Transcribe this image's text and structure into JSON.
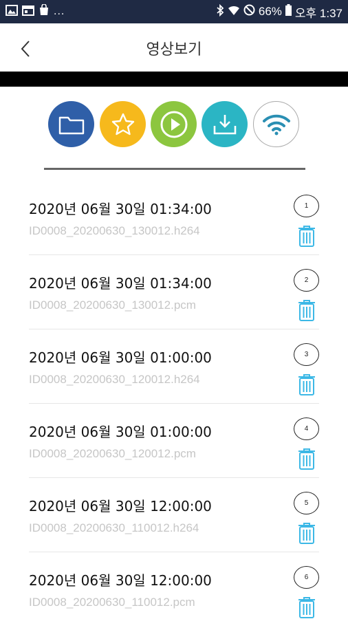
{
  "status_bar": {
    "battery": "66%",
    "time": "오후 1:37",
    "dots": "..."
  },
  "app_bar": {
    "title": "영상보기"
  },
  "tabs": [
    {
      "icon": "folder-icon",
      "color": "#2f5fa8"
    },
    {
      "icon": "star-icon",
      "color": "#f6b91c"
    },
    {
      "icon": "play-icon",
      "color": "#8cc63f"
    },
    {
      "icon": "download-icon",
      "color": "#2bb5c4"
    },
    {
      "icon": "wifi-icon",
      "color": "#ffffff"
    }
  ],
  "colors": {
    "status_bar": "#1f2a44",
    "trash": "#3cb8e6"
  },
  "recordings": [
    {
      "number": "1",
      "date": "2020년 06월 30일 01:34:00",
      "file": "ID0008_20200630_130012.h264"
    },
    {
      "number": "2",
      "date": "2020년 06월 30일 01:34:00",
      "file": "ID0008_20200630_130012.pcm"
    },
    {
      "number": "3",
      "date": "2020년 06월 30일 01:00:00",
      "file": "ID0008_20200630_120012.h264"
    },
    {
      "number": "4",
      "date": "2020년 06월 30일 01:00:00",
      "file": "ID0008_20200630_120012.pcm"
    },
    {
      "number": "5",
      "date": "2020년 06월 30일 12:00:00",
      "file": "ID0008_20200630_110012.h264"
    },
    {
      "number": "6",
      "date": "2020년 06월 30일 12:00:00",
      "file": "ID0008_20200630_110012.pcm"
    }
  ]
}
